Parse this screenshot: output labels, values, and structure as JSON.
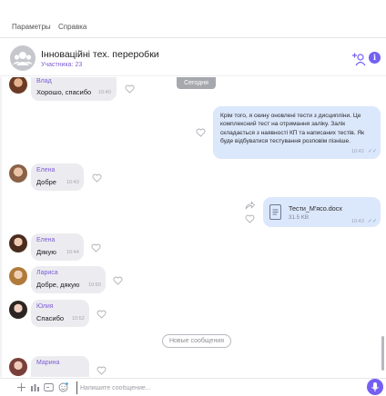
{
  "menu": {
    "items": [
      "Параметры",
      "Справка"
    ]
  },
  "chat": {
    "title": "Інноваційні тех. переробки",
    "subtitle": "Участника: 23"
  },
  "feed": {
    "date_separator": "Сегодня",
    "new_messages_label": "Новые сообщения",
    "messages": [
      {
        "direction": "in",
        "sender": "Влад",
        "text": "Хорошо, спасибо",
        "time": "10:40"
      },
      {
        "direction": "out",
        "text": "Крім того, я скину оновлені тести з дисципліни. Це комплексний тест на отримання заліку. Залік складається з наявності КП та написаних тестів. Як буде відбуватися тестування розповім пізніше.",
        "time": "10:42"
      },
      {
        "direction": "in",
        "sender": "Елена",
        "text": "Добре",
        "time": "10:43"
      },
      {
        "direction": "out",
        "type": "file",
        "file_name": "Тести_М'ясо.docx",
        "file_size": "31.5 KB",
        "time": "10:43"
      },
      {
        "direction": "in",
        "sender": "Елена",
        "text": "Дякую",
        "time": "10:44"
      },
      {
        "direction": "in",
        "sender": "Лариса",
        "text": "Добре, дякую",
        "time": "10:50"
      },
      {
        "direction": "in",
        "sender": "Юлия",
        "text": "Спасибо",
        "time": "10:52"
      },
      {
        "direction": "in",
        "sender": "Марина",
        "text": "",
        "time": ""
      }
    ]
  },
  "composer": {
    "placeholder": "Напишите сообщение..."
  },
  "icons": {
    "group_avatar": "group-avatar-icon",
    "add_member": "add-member-icon",
    "info": "info-icon",
    "heart": "heart-icon",
    "share": "share-icon",
    "file": "document-icon",
    "plus": "plus-icon",
    "sticker": "sticker-icon",
    "gif": "gif-icon",
    "emoji": "emoji-icon",
    "mic": "microphone-icon"
  },
  "colors": {
    "accent": "#7360f2",
    "sender_name": "#7e5dd6",
    "incoming_bubble": "#ececf0",
    "outgoing_bubble": "#dbe7fb",
    "date_pill": "#a5a8ad"
  }
}
